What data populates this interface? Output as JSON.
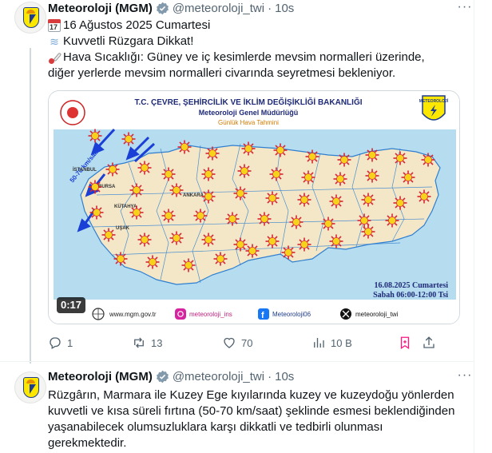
{
  "tweet1": {
    "name": "Meteoroloji (MGM)",
    "handle": "@meteoroloji_twi",
    "time": "10s",
    "lines": [
      "16 Ağustos 2025 Cumartesi",
      "Kuvvetli Rüzgara Dikkat!",
      "Hava Sıcaklığı:  Güney ve iç kesimlerde mevsim normalleri üzerinde,",
      "diğer yerlerde mevsim normalleri civarında seyretmesi bekleniyor."
    ],
    "calendar_emoji_text": "17",
    "media": {
      "ministry": "T.C. ÇEVRE, ŞEHİRCİLİK VE İKLİM DEĞİŞİKLİĞİ BAKANLIĞI",
      "directorate": "Meteoroloji Genel Müdürlüğü",
      "subtitle": "Günlük Hava Tahmini",
      "logo_text": "METEOROLOJİ",
      "date": "16.08.2025 Cumartesi",
      "period": "Sabah 06:00-12:00 Tsi",
      "wind_label": "50-70 km/saat",
      "cities": [
        "ANKARA",
        "İSTANBUL",
        "KÜTAHYA",
        "UŞAK",
        "BURSA"
      ],
      "footer": [
        "www.mgm.gov.tr",
        "meteoroloji_ins",
        "Meteoroloji06",
        "meteoroloji_twi"
      ],
      "duration": "0:17",
      "colors": {
        "land": "#f3e7c8",
        "sea": "#b6dcef",
        "border": "#2f7fd0",
        "sun": "#f7d21a",
        "sun_ray": "#d8222f"
      }
    },
    "actions": {
      "replies": "1",
      "reposts": "13",
      "likes": "70",
      "views": "10 B"
    }
  },
  "tweet2": {
    "name": "Meteoroloji (MGM)",
    "handle": "@meteoroloji_twi",
    "time": "10s",
    "text": "Rüzgârın, Marmara ile Kuzey Ege kıyılarında kuzey ve kuzeydoğu yönlerden kuvvetli ve kısa süreli fırtına (50-70 km/saat) şeklinde esmesi beklendiğinden yaşanabilecek olumsuzluklara karşı dikkatli ve tedbirli olunması gerekmektedir."
  }
}
